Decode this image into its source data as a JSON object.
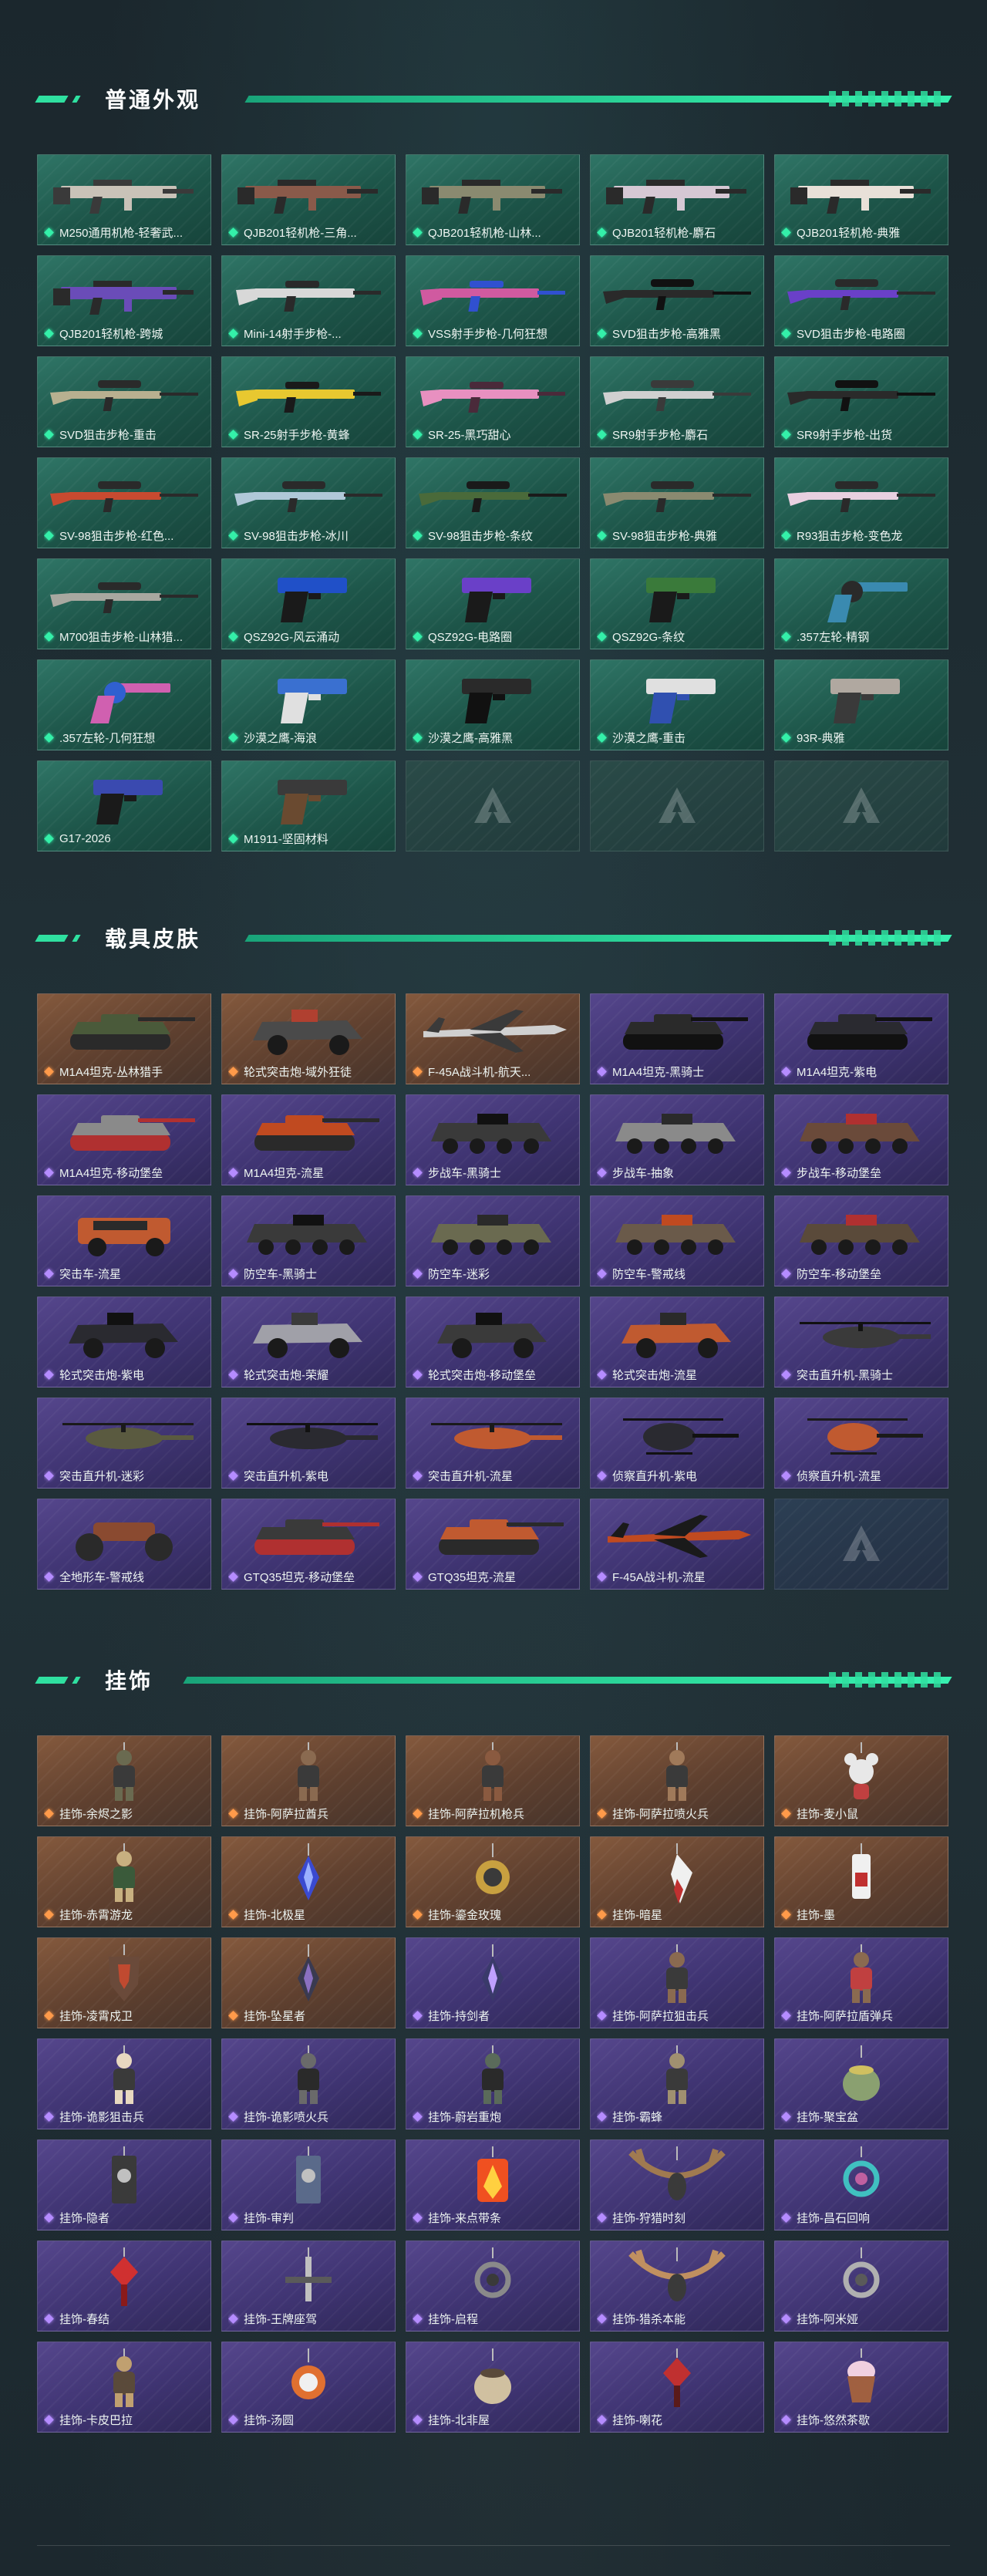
{
  "sections": [
    {
      "id": "normal",
      "title": "普通外观",
      "rarity_colors": {
        "green": "#34f0a9",
        "purple": "#b58cff",
        "orange": "#ff9a4a"
      },
      "items": [
        {
          "label": "M250通用机枪-轻奢武...",
          "rarity": "green",
          "art": "gun",
          "colors": [
            "#c9c2b8",
            "#3a3a3a"
          ]
        },
        {
          "label": "QJB201轻机枪-三角...",
          "rarity": "green",
          "art": "gun",
          "colors": [
            "#8a5a4a",
            "#2a2a2a"
          ]
        },
        {
          "label": "QJB201轻机枪-山林...",
          "rarity": "green",
          "art": "gun",
          "colors": [
            "#8a8a70",
            "#2a2a2a"
          ]
        },
        {
          "label": "QJB201轻机枪-麝石",
          "rarity": "green",
          "art": "gun",
          "colors": [
            "#d6c8d4",
            "#2a2a2a"
          ]
        },
        {
          "label": "QJB201轻机枪-典雅",
          "rarity": "green",
          "art": "gun",
          "colors": [
            "#e8e0d8",
            "#2a2a2a"
          ]
        },
        {
          "label": "QJB201轻机枪-跨城",
          "rarity": "green",
          "art": "gun",
          "colors": [
            "#6a4cb8",
            "#2a2a2a"
          ]
        },
        {
          "label": "Mini-14射手步枪-...",
          "rarity": "green",
          "art": "rifle",
          "colors": [
            "#d8d8d8",
            "#2a2a2a"
          ]
        },
        {
          "label": "VSS射手步枪-几何狂想",
          "rarity": "green",
          "art": "rifle",
          "colors": [
            "#d05aa0",
            "#3050d0"
          ]
        },
        {
          "label": "SVD狙击步枪-高雅黑",
          "rarity": "green",
          "art": "sniper",
          "colors": [
            "#2a2a2a",
            "#111111"
          ]
        },
        {
          "label": "SVD狙击步枪-电路圈",
          "rarity": "green",
          "art": "sniper",
          "colors": [
            "#6a40c8",
            "#2a2a2a"
          ]
        },
        {
          "label": "SVD狙击步枪-重击",
          "rarity": "green",
          "art": "sniper",
          "colors": [
            "#b8b090",
            "#2a2a2a"
          ]
        },
        {
          "label": "SR-25射手步枪-黄蜂",
          "rarity": "green",
          "art": "rifle",
          "colors": [
            "#e8c830",
            "#1a1a1a"
          ]
        },
        {
          "label": "SR-25-黑巧甜心",
          "rarity": "green",
          "art": "rifle",
          "colors": [
            "#e890c0",
            "#4a2a3a"
          ]
        },
        {
          "label": "SR9射手步枪-麝石",
          "rarity": "green",
          "art": "sniper",
          "colors": [
            "#d0d0d0",
            "#3a3a3a"
          ]
        },
        {
          "label": "SR9射手步枪-出货",
          "rarity": "green",
          "art": "sniper",
          "colors": [
            "#2a2a2a",
            "#111111"
          ]
        },
        {
          "label": "SV-98狙击步枪-红色...",
          "rarity": "green",
          "art": "sniper",
          "colors": [
            "#c84a30",
            "#2a2a2a"
          ]
        },
        {
          "label": "SV-98狙击步枪-冰川",
          "rarity": "green",
          "art": "sniper",
          "colors": [
            "#b0c8d8",
            "#2a2a2a"
          ]
        },
        {
          "label": "SV-98狙击步枪-条纹",
          "rarity": "green",
          "art": "sniper",
          "colors": [
            "#4a6a3a",
            "#1a1a1a"
          ]
        },
        {
          "label": "SV-98狙击步枪-典雅",
          "rarity": "green",
          "art": "sniper",
          "colors": [
            "#8a8a70",
            "#2a2a2a"
          ]
        },
        {
          "label": "R93狙击步枪-变色龙",
          "rarity": "green",
          "art": "sniper",
          "colors": [
            "#e8d0e0",
            "#2a2a2a"
          ]
        },
        {
          "label": "M700狙击步枪-山林猎...",
          "rarity": "green",
          "art": "sniper",
          "colors": [
            "#a8a8a0",
            "#2a2a2a"
          ]
        },
        {
          "label": "QSZ92G-风云涌动",
          "rarity": "green",
          "art": "pistol",
          "colors": [
            "#2050c8",
            "#1a1a1a"
          ]
        },
        {
          "label": "QSZ92G-电路圈",
          "rarity": "green",
          "art": "pistol",
          "colors": [
            "#6a40c8",
            "#1a1a1a"
          ]
        },
        {
          "label": "QSZ92G-条纹",
          "rarity": "green",
          "art": "pistol",
          "colors": [
            "#3a7a3a",
            "#1a1a1a"
          ]
        },
        {
          "label": ".357左轮-精钢",
          "rarity": "green",
          "art": "revolver",
          "colors": [
            "#3a8ab0",
            "#2a2a2a"
          ]
        },
        {
          "label": ".357左轮-几何狂想",
          "rarity": "green",
          "art": "revolver",
          "colors": [
            "#d060b0",
            "#3060d0"
          ]
        },
        {
          "label": "沙漠之鹰-海浪",
          "rarity": "green",
          "art": "pistol",
          "colors": [
            "#3a70d0",
            "#e0e0e0"
          ]
        },
        {
          "label": "沙漠之鹰-高雅黑",
          "rarity": "green",
          "art": "pistol",
          "colors": [
            "#2a2a2a",
            "#111111"
          ]
        },
        {
          "label": "沙漠之鹰-重击",
          "rarity": "green",
          "art": "pistol",
          "colors": [
            "#e0e0e0",
            "#3050b0"
          ]
        },
        {
          "label": "93R-典雅",
          "rarity": "green",
          "art": "pistol",
          "colors": [
            "#b0a8a0",
            "#3a3a3a"
          ]
        },
        {
          "label": "G17-2026",
          "rarity": "green",
          "art": "pistol",
          "colors": [
            "#3a4ab0",
            "#1a1a1a"
          ]
        },
        {
          "label": "M1911-坚固材料",
          "rarity": "green",
          "art": "pistol",
          "colors": [
            "#3a3a3a",
            "#6a4a30"
          ]
        },
        {
          "label": "",
          "rarity": "empty"
        },
        {
          "label": "",
          "rarity": "empty"
        },
        {
          "label": "",
          "rarity": "empty"
        }
      ]
    },
    {
      "id": "vehicle",
      "title": "载具皮肤",
      "items": [
        {
          "label": "M1A4坦克-丛林猎手",
          "rarity": "orange",
          "art": "tank",
          "colors": [
            "#4a5a3a",
            "#2a2a2a"
          ]
        },
        {
          "label": "轮式突击炮-域外狂徒",
          "rarity": "orange",
          "art": "jeep",
          "colors": [
            "#4a4a4a",
            "#b04030"
          ]
        },
        {
          "label": "F-45A战斗机-航天...",
          "rarity": "orange",
          "art": "jet",
          "colors": [
            "#d0d0d0",
            "#3a3a3a"
          ]
        },
        {
          "label": "M1A4坦克-黑骑士",
          "rarity": "purple",
          "art": "tank",
          "colors": [
            "#2a2a2a",
            "#111111"
          ]
        },
        {
          "label": "M1A4坦克-紫电",
          "rarity": "purple",
          "art": "tank",
          "colors": [
            "#2a2a30",
            "#111111"
          ]
        },
        {
          "label": "M1A4坦克-移动堡垒",
          "rarity": "purple",
          "art": "tank",
          "colors": [
            "#8a8a8a",
            "#b03030"
          ]
        },
        {
          "label": "M1A4坦克-流星",
          "rarity": "purple",
          "art": "tank",
          "colors": [
            "#c04a20",
            "#2a2a2a"
          ]
        },
        {
          "label": "步战车-黑骑士",
          "rarity": "purple",
          "art": "apc",
          "colors": [
            "#3a3a3a",
            "#111111"
          ]
        },
        {
          "label": "步战车-抽象",
          "rarity": "purple",
          "art": "apc",
          "colors": [
            "#8a8a8a",
            "#2a2a2a"
          ]
        },
        {
          "label": "步战车-移动堡垒",
          "rarity": "purple",
          "art": "apc",
          "colors": [
            "#6a4a3a",
            "#b03030"
          ]
        },
        {
          "label": "突击车-流星",
          "rarity": "purple",
          "art": "suv",
          "colors": [
            "#c05a30",
            "#2a2a2a"
          ]
        },
        {
          "label": "防空车-黑骑士",
          "rarity": "purple",
          "art": "apc",
          "colors": [
            "#3a3a3a",
            "#111111"
          ]
        },
        {
          "label": "防空车-迷彩",
          "rarity": "purple",
          "art": "apc",
          "colors": [
            "#6a6a50",
            "#2a2a2a"
          ]
        },
        {
          "label": "防空车-警戒线",
          "rarity": "purple",
          "art": "apc",
          "colors": [
            "#6a5a4a",
            "#c04a20"
          ]
        },
        {
          "label": "防空车-移动堡垒",
          "rarity": "purple",
          "art": "apc",
          "colors": [
            "#5a4a3a",
            "#b03030"
          ]
        },
        {
          "label": "轮式突击炮-紫电",
          "rarity": "purple",
          "art": "jeep",
          "colors": [
            "#2a2a30",
            "#111111"
          ]
        },
        {
          "label": "轮式突击炮-荣耀",
          "rarity": "purple",
          "art": "jeep",
          "colors": [
            "#a0a0a8",
            "#3a3a3a"
          ]
        },
        {
          "label": "轮式突击炮-移动堡垒",
          "rarity": "purple",
          "art": "jeep",
          "colors": [
            "#3a3a3a",
            "#111111"
          ]
        },
        {
          "label": "轮式突击炮-流星",
          "rarity": "purple",
          "art": "jeep",
          "colors": [
            "#c05a30",
            "#2a2a2a"
          ]
        },
        {
          "label": "突击直升机-黑骑士",
          "rarity": "purple",
          "art": "heli",
          "colors": [
            "#3a3a3a",
            "#111111"
          ]
        },
        {
          "label": "突击直升机-迷彩",
          "rarity": "purple",
          "art": "heli",
          "colors": [
            "#5a5a40",
            "#1a1a1a"
          ]
        },
        {
          "label": "突击直升机-紫电",
          "rarity": "purple",
          "art": "heli",
          "colors": [
            "#2a2a30",
            "#111111"
          ]
        },
        {
          "label": "突击直升机-流星",
          "rarity": "purple",
          "art": "heli",
          "colors": [
            "#c05a30",
            "#1a1a1a"
          ]
        },
        {
          "label": "侦察直升机-紫电",
          "rarity": "purple",
          "art": "heli2",
          "colors": [
            "#2a2a30",
            "#111111"
          ]
        },
        {
          "label": "侦察直升机-流星",
          "rarity": "purple",
          "art": "heli2",
          "colors": [
            "#c05a30",
            "#1a1a1a"
          ]
        },
        {
          "label": "全地形车-警戒线",
          "rarity": "purple",
          "art": "atv",
          "colors": [
            "#8a4a30",
            "#2a2a2a"
          ]
        },
        {
          "label": "GTQ35坦克-移动堡垒",
          "rarity": "purple",
          "art": "tank",
          "colors": [
            "#3a3a3a",
            "#b03030"
          ]
        },
        {
          "label": "GTQ35坦克-流星",
          "rarity": "purple",
          "art": "tank",
          "colors": [
            "#c05a30",
            "#2a2a2a"
          ]
        },
        {
          "label": "F-45A战斗机-流星",
          "rarity": "purple",
          "art": "jet",
          "colors": [
            "#c04a20",
            "#1a1a1a"
          ]
        },
        {
          "label": "",
          "rarity": "empty-v"
        }
      ]
    },
    {
      "id": "charm",
      "title": "挂饰",
      "items": [
        {
          "label": "挂饰-余烬之影",
          "rarity": "orange",
          "art": "figure",
          "colors": [
            "#6a6a50",
            "#3a3a3a"
          ]
        },
        {
          "label": "挂饰-阿萨拉酋兵",
          "rarity": "orange",
          "art": "figure",
          "colors": [
            "#8a6a50",
            "#3a3a3a"
          ]
        },
        {
          "label": "挂饰-阿萨拉机枪兵",
          "rarity": "orange",
          "art": "figure",
          "colors": [
            "#8a5a40",
            "#3a3a3a"
          ]
        },
        {
          "label": "挂饰-阿萨拉喷火兵",
          "rarity": "orange",
          "art": "figure",
          "colors": [
            "#a07a5a",
            "#3a3a3a"
          ]
        },
        {
          "label": "挂饰-麦小鼠",
          "rarity": "orange",
          "art": "mouse",
          "colors": [
            "#e8e8e8",
            "#c04040"
          ]
        },
        {
          "label": "挂饰-赤霄游龙",
          "rarity": "orange",
          "art": "figure",
          "colors": [
            "#c8b080",
            "#3a5a3a"
          ]
        },
        {
          "label": "挂饰-北极星",
          "rarity": "orange",
          "art": "crystal",
          "colors": [
            "#3a4ad0",
            "#9ab0ff"
          ]
        },
        {
          "label": "挂饰-鎏金玫瑰",
          "rarity": "orange",
          "art": "medal",
          "colors": [
            "#c8a040",
            "#3a3a3a"
          ]
        },
        {
          "label": "挂饰-暗星",
          "rarity": "orange",
          "art": "feather",
          "colors": [
            "#f0f0f0",
            "#c03030"
          ]
        },
        {
          "label": "挂饰-墨",
          "rarity": "orange",
          "art": "tag",
          "colors": [
            "#f0f0f0",
            "#c03030"
          ]
        },
        {
          "label": "挂饰-凌霄戍卫",
          "rarity": "orange",
          "art": "shield",
          "colors": [
            "#6a4a3a",
            "#c04a30"
          ]
        },
        {
          "label": "挂饰-坠星者",
          "rarity": "orange",
          "art": "crystal",
          "colors": [
            "#3a3a50",
            "#8a70c0"
          ]
        },
        {
          "label": "挂饰-持剑者",
          "rarity": "purple",
          "art": "crystal",
          "colors": [
            "#3a3a6a",
            "#c0a0ff"
          ]
        },
        {
          "label": "挂饰-阿萨拉狙击兵",
          "rarity": "purple",
          "art": "figure",
          "colors": [
            "#8a6a50",
            "#3a3a3a"
          ]
        },
        {
          "label": "挂饰-阿萨拉盾弹兵",
          "rarity": "purple",
          "art": "figure",
          "colors": [
            "#8a6a50",
            "#c04040"
          ]
        },
        {
          "label": "挂饰-诡影狙击兵",
          "rarity": "purple",
          "art": "figure",
          "colors": [
            "#e8d8c0",
            "#3a3a3a"
          ]
        },
        {
          "label": "挂饰-诡影喷火兵",
          "rarity": "purple",
          "art": "figure",
          "colors": [
            "#6a6a6a",
            "#2a2a2a"
          ]
        },
        {
          "label": "挂饰-蔚岩重炮",
          "rarity": "purple",
          "art": "figure",
          "colors": [
            "#5a6a5a",
            "#2a2a2a"
          ]
        },
        {
          "label": "挂饰-霸蜂",
          "rarity": "purple",
          "art": "figure",
          "colors": [
            "#a09070",
            "#3a3a3a"
          ]
        },
        {
          "label": "挂饰-聚宝盆",
          "rarity": "purple",
          "art": "pot",
          "colors": [
            "#8aa070",
            "#d0c060"
          ]
        },
        {
          "label": "挂饰-隐者",
          "rarity": "purple",
          "art": "card",
          "colors": [
            "#3a3a3a",
            "#c0c0c0"
          ]
        },
        {
          "label": "挂饰-审判",
          "rarity": "purple",
          "art": "card",
          "colors": [
            "#5a6a8a",
            "#c0c0c0"
          ]
        },
        {
          "label": "挂饰-来点带条",
          "rarity": "purple",
          "art": "fire",
          "colors": [
            "#f05020",
            "#ffd040"
          ]
        },
        {
          "label": "挂饰-狩猎时刻",
          "rarity": "purple",
          "art": "antler",
          "colors": [
            "#a07a50",
            "#3a3a3a"
          ]
        },
        {
          "label": "挂饰-昌石回响",
          "rarity": "purple",
          "art": "ring",
          "colors": [
            "#40c0c0",
            "#c060a0"
          ]
        },
        {
          "label": "挂饰-春结",
          "rarity": "purple",
          "art": "knot",
          "colors": [
            "#d03030",
            "#8a1a1a"
          ]
        },
        {
          "label": "挂饰-王牌座驾",
          "rarity": "purple",
          "art": "plane",
          "colors": [
            "#c0c0c0",
            "#5a5a5a"
          ]
        },
        {
          "label": "挂饰-启程",
          "rarity": "purple",
          "art": "ring",
          "colors": [
            "#8a8a8a",
            "#3a3a3a"
          ]
        },
        {
          "label": "挂饰-猎杀本能",
          "rarity": "purple",
          "art": "antler",
          "colors": [
            "#c09060",
            "#3a3a3a"
          ]
        },
        {
          "label": "挂饰-阿米娅",
          "rarity": "purple",
          "art": "ring",
          "colors": [
            "#b0b0b0",
            "#5a5a5a"
          ]
        },
        {
          "label": "挂饰-卡皮巴拉",
          "rarity": "purple",
          "art": "figure",
          "colors": [
            "#c0a070",
            "#5a4a3a"
          ]
        },
        {
          "label": "挂饰-汤圆",
          "rarity": "purple",
          "art": "medal",
          "colors": [
            "#e07030",
            "#f0f0f0"
          ]
        },
        {
          "label": "挂饰-北非屋",
          "rarity": "purple",
          "art": "pot",
          "colors": [
            "#d0c0a0",
            "#5a4a3a"
          ]
        },
        {
          "label": "挂饰-喇花",
          "rarity": "purple",
          "art": "knot",
          "colors": [
            "#c03030",
            "#5a1a1a"
          ]
        },
        {
          "label": "挂饰-悠然茶歇",
          "rarity": "purple",
          "art": "cake",
          "colors": [
            "#f0d0e0",
            "#a06040"
          ]
        }
      ]
    }
  ]
}
